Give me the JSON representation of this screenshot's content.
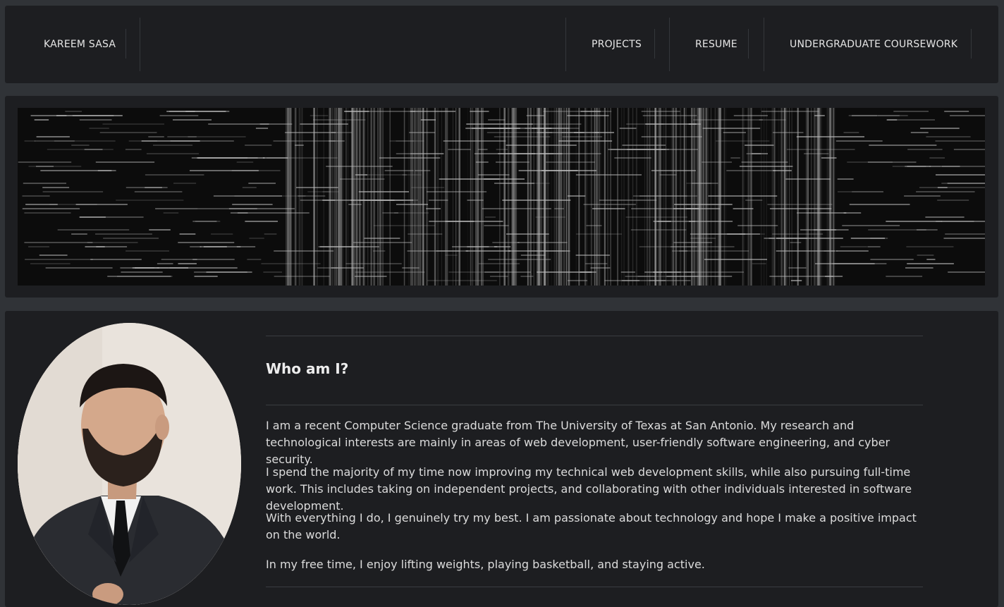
{
  "nav": {
    "brand": "KAREEM SASA",
    "links": [
      "PROJECTS",
      "RESUME",
      "UNDERGRADUATE COURSEWORK"
    ]
  },
  "banner": {
    "image": "code-collage-banner"
  },
  "about": {
    "photo": "profile-portrait",
    "heading": "Who am I?",
    "paragraphs": [
      "I am a recent Computer Science graduate from The University of Texas at San Antonio. My research and technological interests are mainly in areas of web development, user-friendly software engineering, and cyber security.",
      "I spend the majority of my time now improving my technical web development skills, while also pursuing full-time work. This includes taking on independent projects, and collaborating with other individuals interested in software development.",
      "With everything I do, I genuinely try my best. I am passionate about technology and hope I make a positive impact on the world.",
      "In my free time, I enjoy lifting weights, playing basketball, and staying active."
    ]
  },
  "colors": {
    "page_bg": "#303337",
    "panel_bg": "#1d1e21",
    "text": "#dcdcdc",
    "divider": "#3a3d41"
  }
}
